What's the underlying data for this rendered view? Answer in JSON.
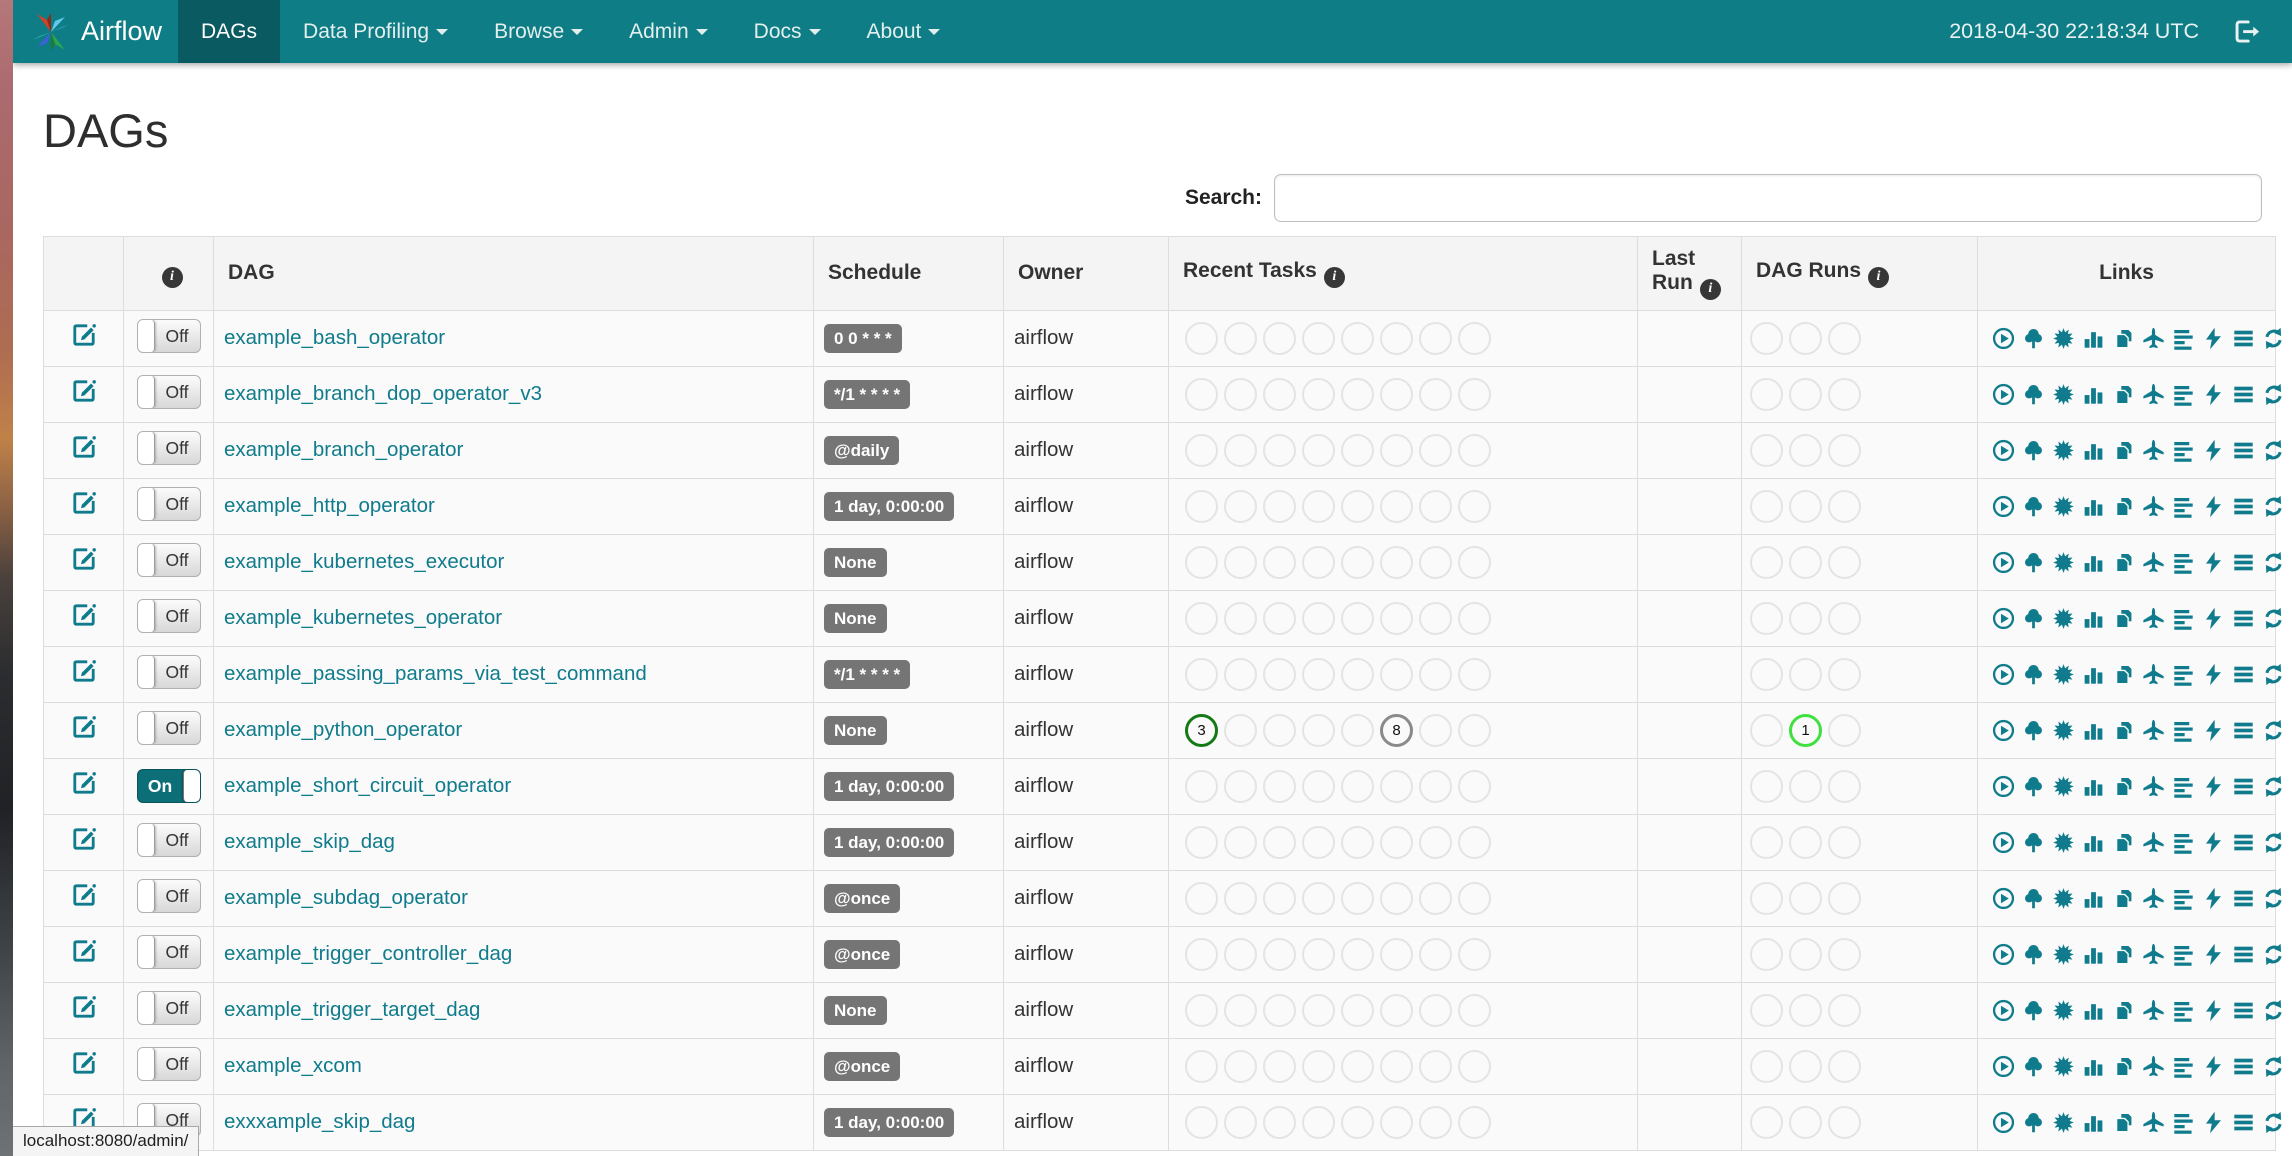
{
  "navbar": {
    "brand": "Airflow",
    "items": [
      {
        "label": "DAGs",
        "active": true,
        "caret": false
      },
      {
        "label": "Data Profiling",
        "active": false,
        "caret": true
      },
      {
        "label": "Browse",
        "active": false,
        "caret": true
      },
      {
        "label": "Admin",
        "active": false,
        "caret": true
      },
      {
        "label": "Docs",
        "active": false,
        "caret": true
      },
      {
        "label": "About",
        "active": false,
        "caret": true
      }
    ],
    "clock": "2018-04-30 22:18:34 UTC",
    "colors": {
      "bg": "#0e7d85",
      "active_bg": "#0a5a61"
    }
  },
  "page": {
    "title": "DAGs",
    "search_label": "Search:",
    "search_value": ""
  },
  "table": {
    "headers": {
      "dag": "DAG",
      "schedule": "Schedule",
      "owner": "Owner",
      "recent_tasks": "Recent Tasks",
      "last_run_line1": "Last",
      "last_run_line2": "Run",
      "dag_runs": "DAG Runs",
      "links": "Links"
    },
    "info_glyph": "i",
    "recent_task_slots": 8,
    "dag_run_slots": 3,
    "state_colors": {
      "success": "#157a15",
      "queued": "#8a8a8a",
      "running": "#3fe03f",
      "none": "#e4e4e4"
    },
    "link_icons": [
      "trigger-dag-icon",
      "tree-view-icon",
      "graph-view-icon",
      "task-duration-icon",
      "task-tries-icon",
      "landing-times-icon",
      "gantt-icon",
      "code-view-icon",
      "logs-icon",
      "refresh-icon"
    ],
    "rows": [
      {
        "name": "example_bash_operator",
        "toggle": "Off",
        "schedule": "0 0 * * *",
        "owner": "airflow",
        "recent_tasks": [],
        "last_run": "",
        "dag_runs": []
      },
      {
        "name": "example_branch_dop_operator_v3",
        "toggle": "Off",
        "schedule": "*/1 * * * *",
        "owner": "airflow",
        "recent_tasks": [],
        "last_run": "",
        "dag_runs": []
      },
      {
        "name": "example_branch_operator",
        "toggle": "Off",
        "schedule": "@daily",
        "owner": "airflow",
        "recent_tasks": [],
        "last_run": "",
        "dag_runs": []
      },
      {
        "name": "example_http_operator",
        "toggle": "Off",
        "schedule": "1 day, 0:00:00",
        "owner": "airflow",
        "recent_tasks": [],
        "last_run": "",
        "dag_runs": []
      },
      {
        "name": "example_kubernetes_executor",
        "toggle": "Off",
        "schedule": "None",
        "owner": "airflow",
        "recent_tasks": [],
        "last_run": "",
        "dag_runs": []
      },
      {
        "name": "example_kubernetes_operator",
        "toggle": "Off",
        "schedule": "None",
        "owner": "airflow",
        "recent_tasks": [],
        "last_run": "",
        "dag_runs": []
      },
      {
        "name": "example_passing_params_via_test_command",
        "toggle": "Off",
        "schedule": "*/1 * * * *",
        "owner": "airflow",
        "recent_tasks": [],
        "last_run": "",
        "dag_runs": []
      },
      {
        "name": "example_python_operator",
        "toggle": "Off",
        "schedule": "None",
        "owner": "airflow",
        "recent_tasks": [
          {
            "slot": 0,
            "count": "3",
            "state": "success"
          },
          {
            "slot": 5,
            "count": "8",
            "state": "queued"
          }
        ],
        "last_run": "",
        "dag_runs": [
          {
            "slot": 1,
            "count": "1",
            "state": "running"
          }
        ]
      },
      {
        "name": "example_short_circuit_operator",
        "toggle": "On",
        "schedule": "1 day, 0:00:00",
        "owner": "airflow",
        "recent_tasks": [],
        "last_run": "",
        "dag_runs": []
      },
      {
        "name": "example_skip_dag",
        "toggle": "Off",
        "schedule": "1 day, 0:00:00",
        "owner": "airflow",
        "recent_tasks": [],
        "last_run": "",
        "dag_runs": []
      },
      {
        "name": "example_subdag_operator",
        "toggle": "Off",
        "schedule": "@once",
        "owner": "airflow",
        "recent_tasks": [],
        "last_run": "",
        "dag_runs": []
      },
      {
        "name": "example_trigger_controller_dag",
        "toggle": "Off",
        "schedule": "@once",
        "owner": "airflow",
        "recent_tasks": [],
        "last_run": "",
        "dag_runs": []
      },
      {
        "name": "example_trigger_target_dag",
        "toggle": "Off",
        "schedule": "None",
        "owner": "airflow",
        "recent_tasks": [],
        "last_run": "",
        "dag_runs": []
      },
      {
        "name": "example_xcom",
        "toggle": "Off",
        "schedule": "@once",
        "owner": "airflow",
        "recent_tasks": [],
        "last_run": "",
        "dag_runs": []
      },
      {
        "name": "exxxample_skip_dag",
        "toggle": "Off",
        "schedule": "1 day, 0:00:00",
        "owner": "airflow",
        "recent_tasks": [],
        "last_run": "",
        "dag_runs": []
      }
    ]
  },
  "browser": {
    "status_url": "localhost:8080/admin/"
  }
}
